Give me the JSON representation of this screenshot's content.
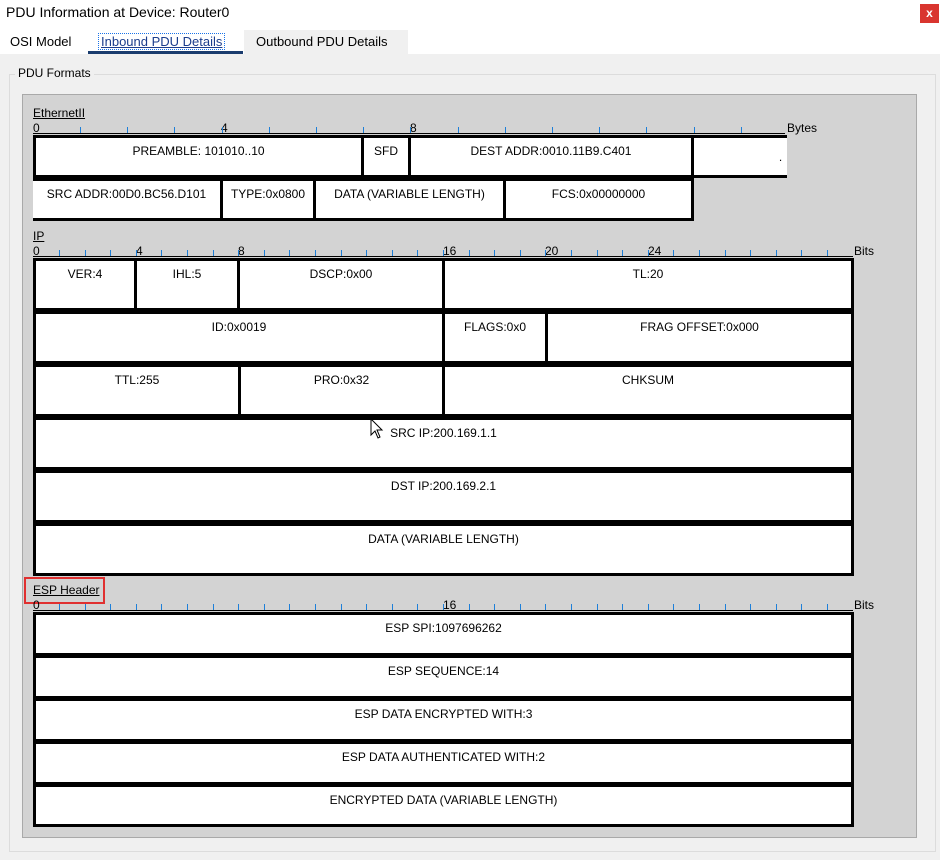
{
  "window": {
    "title": "PDU Information at Device: Router0",
    "close_label": "x"
  },
  "tabs": [
    {
      "label": "OSI Model"
    },
    {
      "label": "Inbound PDU Details"
    },
    {
      "label": "Outbound PDU Details"
    }
  ],
  "group": {
    "legend": "PDU Formats"
  },
  "ethernet": {
    "label": "EthernetII",
    "ruler_numbers": [
      "0",
      "4",
      "8"
    ],
    "unit": "Bytes",
    "row1": [
      "PREAMBLE: 101010..10",
      "SFD",
      "DEST ADDR:0010.11B9.C401",
      "."
    ],
    "row2": [
      "SRC ADDR:00D0.BC56.D101",
      "TYPE:0x0800",
      "DATA (VARIABLE LENGTH)",
      "FCS:0x00000000"
    ]
  },
  "ip": {
    "label": "IP",
    "ruler_numbers": [
      "0",
      "4",
      "8",
      "16",
      "20",
      "24"
    ],
    "unit": "Bits",
    "row1": [
      "VER:4",
      "IHL:5",
      "DSCP:0x00",
      "TL:20"
    ],
    "row2": [
      "ID:0x0019",
      "FLAGS:0x0",
      "FRAG OFFSET:0x000"
    ],
    "row3": [
      "TTL:255",
      "PRO:0x32",
      "CHKSUM"
    ],
    "row4": "SRC IP:200.169.1.1",
    "row5": "DST IP:200.169.2.1",
    "row6": "DATA (VARIABLE LENGTH)"
  },
  "esp": {
    "label": "ESP Header",
    "ruler_numbers": [
      "0",
      "16"
    ],
    "unit": "Bits",
    "rows": [
      "ESP SPI:1097696262",
      "ESP SEQUENCE:14",
      "ESP DATA ENCRYPTED WITH:3",
      "ESP DATA AUTHENTICATED WITH:2",
      "ENCRYPTED DATA (VARIABLE LENGTH)"
    ]
  }
}
